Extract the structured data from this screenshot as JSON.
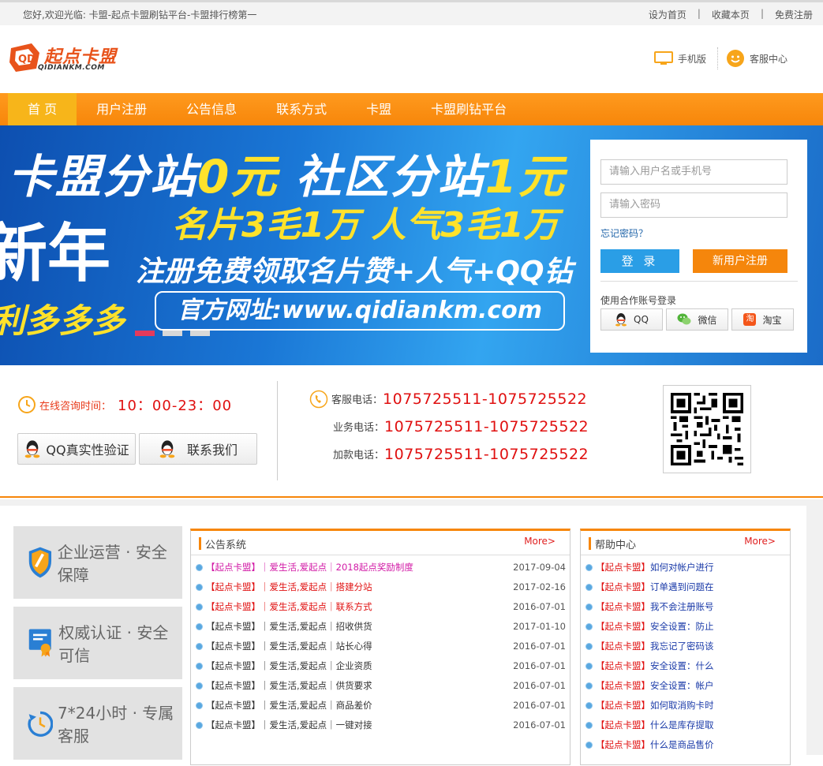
{
  "topbar": {
    "welcome": "您好,欢迎光临: 卡盟-起点卡盟刷钻平台-卡盟排行榜第一",
    "links": [
      "设为首页",
      "收藏本页",
      "免费注册"
    ]
  },
  "header": {
    "logo_text": "起点卡盟",
    "logo_sub": "QIDIANKM.COM",
    "mobile_label": "手机版",
    "service_label": "客服中心"
  },
  "nav": {
    "items": [
      "首 页",
      "用户注册",
      "公告信息",
      "联系方式",
      "卡盟",
      "卡盟刷钻平台"
    ],
    "active_index": 0
  },
  "banner": {
    "line1a": "卡盟分站",
    "line1b": "0元",
    "line1c": " 社区分站",
    "line1d": "1元",
    "line2": "名片3毛1万 人气3毛1万",
    "line3": "新年",
    "line4": "注册免费领取名片赞+人气+QQ钻",
    "line5": "利多多多",
    "line6": "官方网址:www.qidiankm.com",
    "active_slide": 0,
    "slide_count": 3
  },
  "login": {
    "username_placeholder": "请输入用户名或手机号",
    "password_placeholder": "请输入密码",
    "forgot": "忘记密码？",
    "login_button": "登 录",
    "register_button": "新用户注册",
    "partner_label": "使用合作账号登录",
    "partners": [
      "QQ",
      "微信",
      "淘宝"
    ]
  },
  "contact": {
    "time_label": "在线咨询时间：",
    "time_value": "10：00-23：00",
    "qq_verify_button": "QQ真实性验证",
    "contact_button": "联系我们",
    "phones": [
      {
        "label": "客服电话：",
        "number": "1075725511-1075725522"
      },
      {
        "label": "业务电话：",
        "number": "1075725511-1075725522"
      },
      {
        "label": "加款电话：",
        "number": "1075725511-1075725522"
      }
    ]
  },
  "features": [
    "企业运营 · 安全保障",
    "权威认证 · 安全可信",
    "7*24小时 · 专属客服"
  ],
  "notice": {
    "title": "公告系统",
    "more": "More>",
    "items": [
      {
        "text": "【起点卡盟】｜爱生活,爱起点｜2018起点奖励制度",
        "date": "2017-09-04",
        "color": "pink"
      },
      {
        "text": "【起点卡盟】｜爱生活,爱起点｜搭建分站",
        "date": "2017-02-16",
        "color": "red"
      },
      {
        "text": "【起点卡盟】｜爱生活,爱起点｜联系方式",
        "date": "2016-07-01",
        "color": "red"
      },
      {
        "text": "【起点卡盟】｜爱生活,爱起点｜招收供货",
        "date": "2017-01-10",
        "color": "dark"
      },
      {
        "text": "【起点卡盟】｜爱生活,爱起点｜站长心得",
        "date": "2016-07-01",
        "color": "dark"
      },
      {
        "text": "【起点卡盟】｜爱生活,爱起点｜企业资质",
        "date": "2016-07-01",
        "color": "dark"
      },
      {
        "text": "【起点卡盟】｜爱生活,爱起点｜供货要求",
        "date": "2016-07-01",
        "color": "dark"
      },
      {
        "text": "【起点卡盟】｜爱生活,爱起点｜商品差价",
        "date": "2016-07-01",
        "color": "dark"
      },
      {
        "text": "【起点卡盟】｜爱生活,爱起点｜一键对接",
        "date": "2016-07-01",
        "color": "dark"
      }
    ]
  },
  "help": {
    "title": "帮助中心",
    "more": "More>",
    "items": [
      {
        "prefix": "【起点卡盟】",
        "text": "如何对帐户进行"
      },
      {
        "prefix": "【起点卡盟】",
        "text": "订单遇到问题在"
      },
      {
        "prefix": "【起点卡盟】",
        "text": "我不会注册账号"
      },
      {
        "prefix": "【起点卡盟】",
        "text": "安全设置：防止"
      },
      {
        "prefix": "【起点卡盟】",
        "text": "我忘记了密码该"
      },
      {
        "prefix": "【起点卡盟】",
        "text": "安全设置：什么"
      },
      {
        "prefix": "【起点卡盟】",
        "text": "安全设置：帐户"
      },
      {
        "prefix": "【起点卡盟】",
        "text": "如何取消购卡时"
      },
      {
        "prefix": "【起点卡盟】",
        "text": "什么是库存提取"
      },
      {
        "prefix": "【起点卡盟】",
        "text": "什么是商品售价"
      }
    ]
  },
  "colors": {
    "accent": "#f7860a",
    "nav_active": "#f7b51a",
    "login_blue": "#2a9ee6",
    "phone_red": "#e01010"
  }
}
